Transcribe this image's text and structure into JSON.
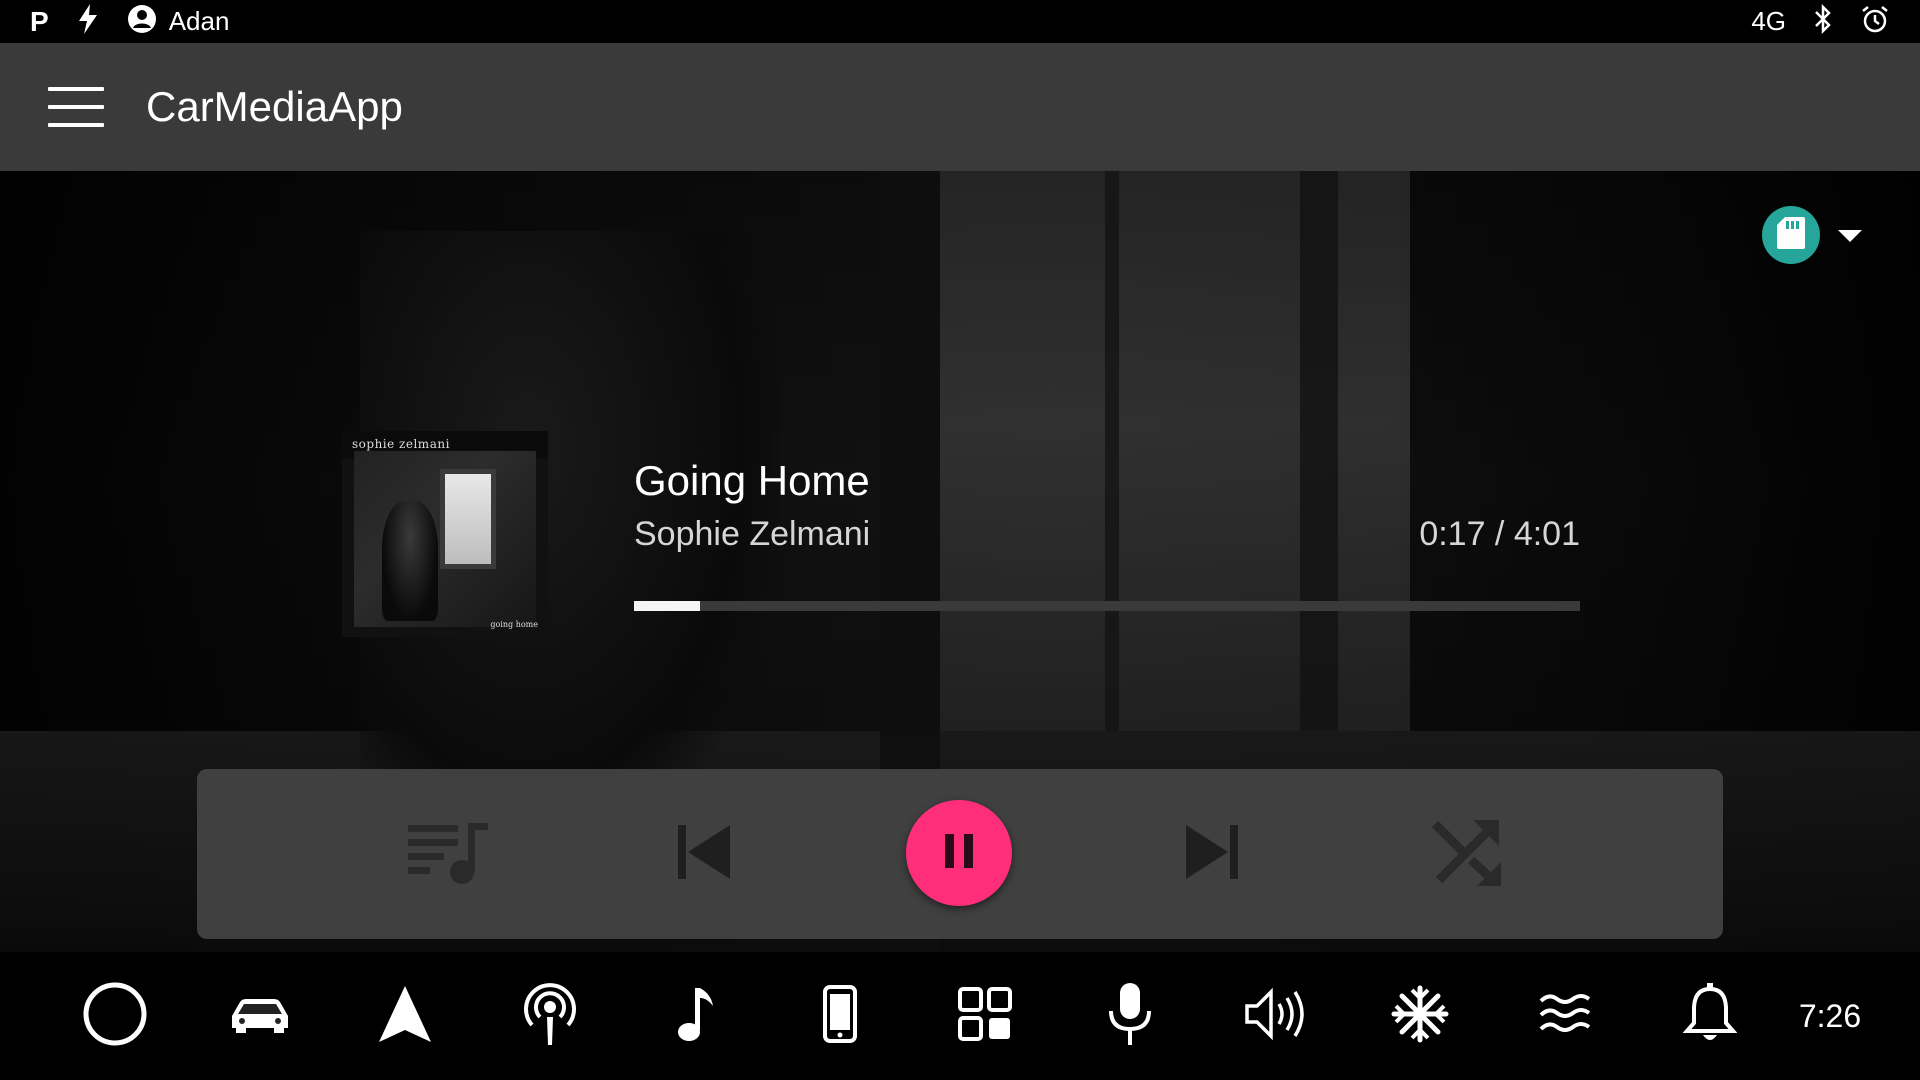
{
  "status_bar": {
    "parking_label": "P",
    "user_name": "Adan",
    "network": "4G"
  },
  "app_bar": {
    "title": "CarMediaApp"
  },
  "now_playing": {
    "album_artist_text": "sophie zelmani",
    "album_title_text": "going home",
    "title": "Going Home",
    "artist": "Sophie Zelmani",
    "time": "0:17 / 4:01",
    "progress_fraction": 0.07
  },
  "source": {
    "icon": "sd-card-icon"
  },
  "colors": {
    "accent": "#ff2e7a",
    "source_badge": "#26a69a",
    "app_bar": "#3a3a3a"
  },
  "controls": [
    "queue-music-icon",
    "skip-previous-icon",
    "pause-icon",
    "skip-next-icon",
    "shuffle-icon"
  ],
  "bottom_nav": {
    "icons": [
      "home-icon",
      "car-icon",
      "navigation-icon",
      "podcast-icon",
      "music-note-icon",
      "phone-icon",
      "apps-grid-icon",
      "microphone-icon",
      "volume-icon",
      "fan-icon",
      "heat-icon",
      "notifications-icon"
    ],
    "clock": "7:26"
  }
}
